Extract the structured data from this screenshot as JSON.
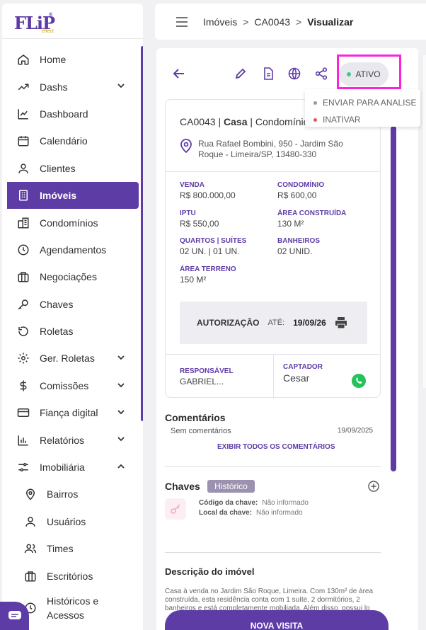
{
  "logo": {
    "text": "FLiP",
    "sub": "effect",
    "mark": "®"
  },
  "sidebar": {
    "items": [
      {
        "label": "Home"
      },
      {
        "label": "Dashs"
      },
      {
        "label": "Dashboard"
      },
      {
        "label": "Calendário"
      },
      {
        "label": "Clientes"
      },
      {
        "label": "Imóveis"
      },
      {
        "label": "Condomínios"
      },
      {
        "label": "Agendamentos"
      },
      {
        "label": "Negociações"
      },
      {
        "label": "Chaves"
      },
      {
        "label": "Roletas"
      },
      {
        "label": "Ger. Roletas"
      },
      {
        "label": "Comissões"
      },
      {
        "label": "Fiança digital"
      },
      {
        "label": "Relatórios"
      },
      {
        "label": "Imobiliária"
      },
      {
        "label": "Bairros"
      },
      {
        "label": "Usuários"
      },
      {
        "label": "Times"
      },
      {
        "label": "Escritórios"
      },
      {
        "label": "Históricos e Acessos"
      }
    ]
  },
  "topbar": {
    "crumb1": "Imóveis",
    "crumb2": "CA0043",
    "current": "Visualizar",
    "sep": ">"
  },
  "status": {
    "label": "ATIVO",
    "color": "#3cc98a"
  },
  "dropdown": {
    "options": [
      {
        "label": "ENVIAR PARA ANALISE",
        "color": "#999999"
      },
      {
        "label": "INATIVAR",
        "color": "#e05a4e"
      }
    ]
  },
  "property": {
    "code": "CA0043",
    "type": "Casa",
    "category": "Condomínio",
    "sep": "|",
    "address": "Rua Rafael Bombini, 950 - Jardim São Roque - Limeira/SP, 13480-330",
    "fields": {
      "venda": {
        "k": "VENDA",
        "v": "R$ 800.000,00"
      },
      "condominio": {
        "k": "CONDOMÍNIO",
        "v": "R$ 600,00"
      },
      "iptu": {
        "k": "IPTU",
        "v": "R$ 550,00"
      },
      "area_construida": {
        "k": "ÁREA CONSTRUÍDA",
        "v": "130 M²"
      },
      "quartos": {
        "k": "QUARTOS | SUÍTES",
        "v": "02 UN. | 01 UN."
      },
      "banheiros": {
        "k": "BANHEIROS",
        "v": "02 UNID."
      },
      "area_terreno": {
        "k": "ÁREA TERRENO",
        "v": "150 M²"
      }
    },
    "auth": {
      "label": "AUTORIZAÇÃO",
      "ate": "ATÉ:",
      "date": "19/09/26"
    },
    "responsavel": {
      "k": "RESPONSÁVEL",
      "v": "GABRIEL..."
    },
    "captador": {
      "k": "CAPTADOR",
      "v": "Cesar"
    }
  },
  "comments": {
    "title": "Comentários",
    "empty": "Sem comentários",
    "date": "19/09/2025",
    "show_all": "EXIBIR TODOS OS COMENTÁRIOS"
  },
  "keys": {
    "title": "Chaves",
    "history": "Histórico",
    "code_label": "Código da chave:",
    "code_value": "Não informado",
    "place_label": "Local da chave:",
    "place_value": "Não informado"
  },
  "description": {
    "title": "Descrição do imóvel",
    "text": "Casa à venda no Jardim São Roque, Limeira. Com 130m² de área construída, esta residência conta com 1 suíte, 2 dormitórios, 2 banheiros e está completamente mobiliada. Além disso, possui lo"
  },
  "cta": {
    "label": "NOVA VISITA"
  },
  "colors": {
    "primary": "#5e3ca6",
    "highlight": "#ff22dd"
  }
}
